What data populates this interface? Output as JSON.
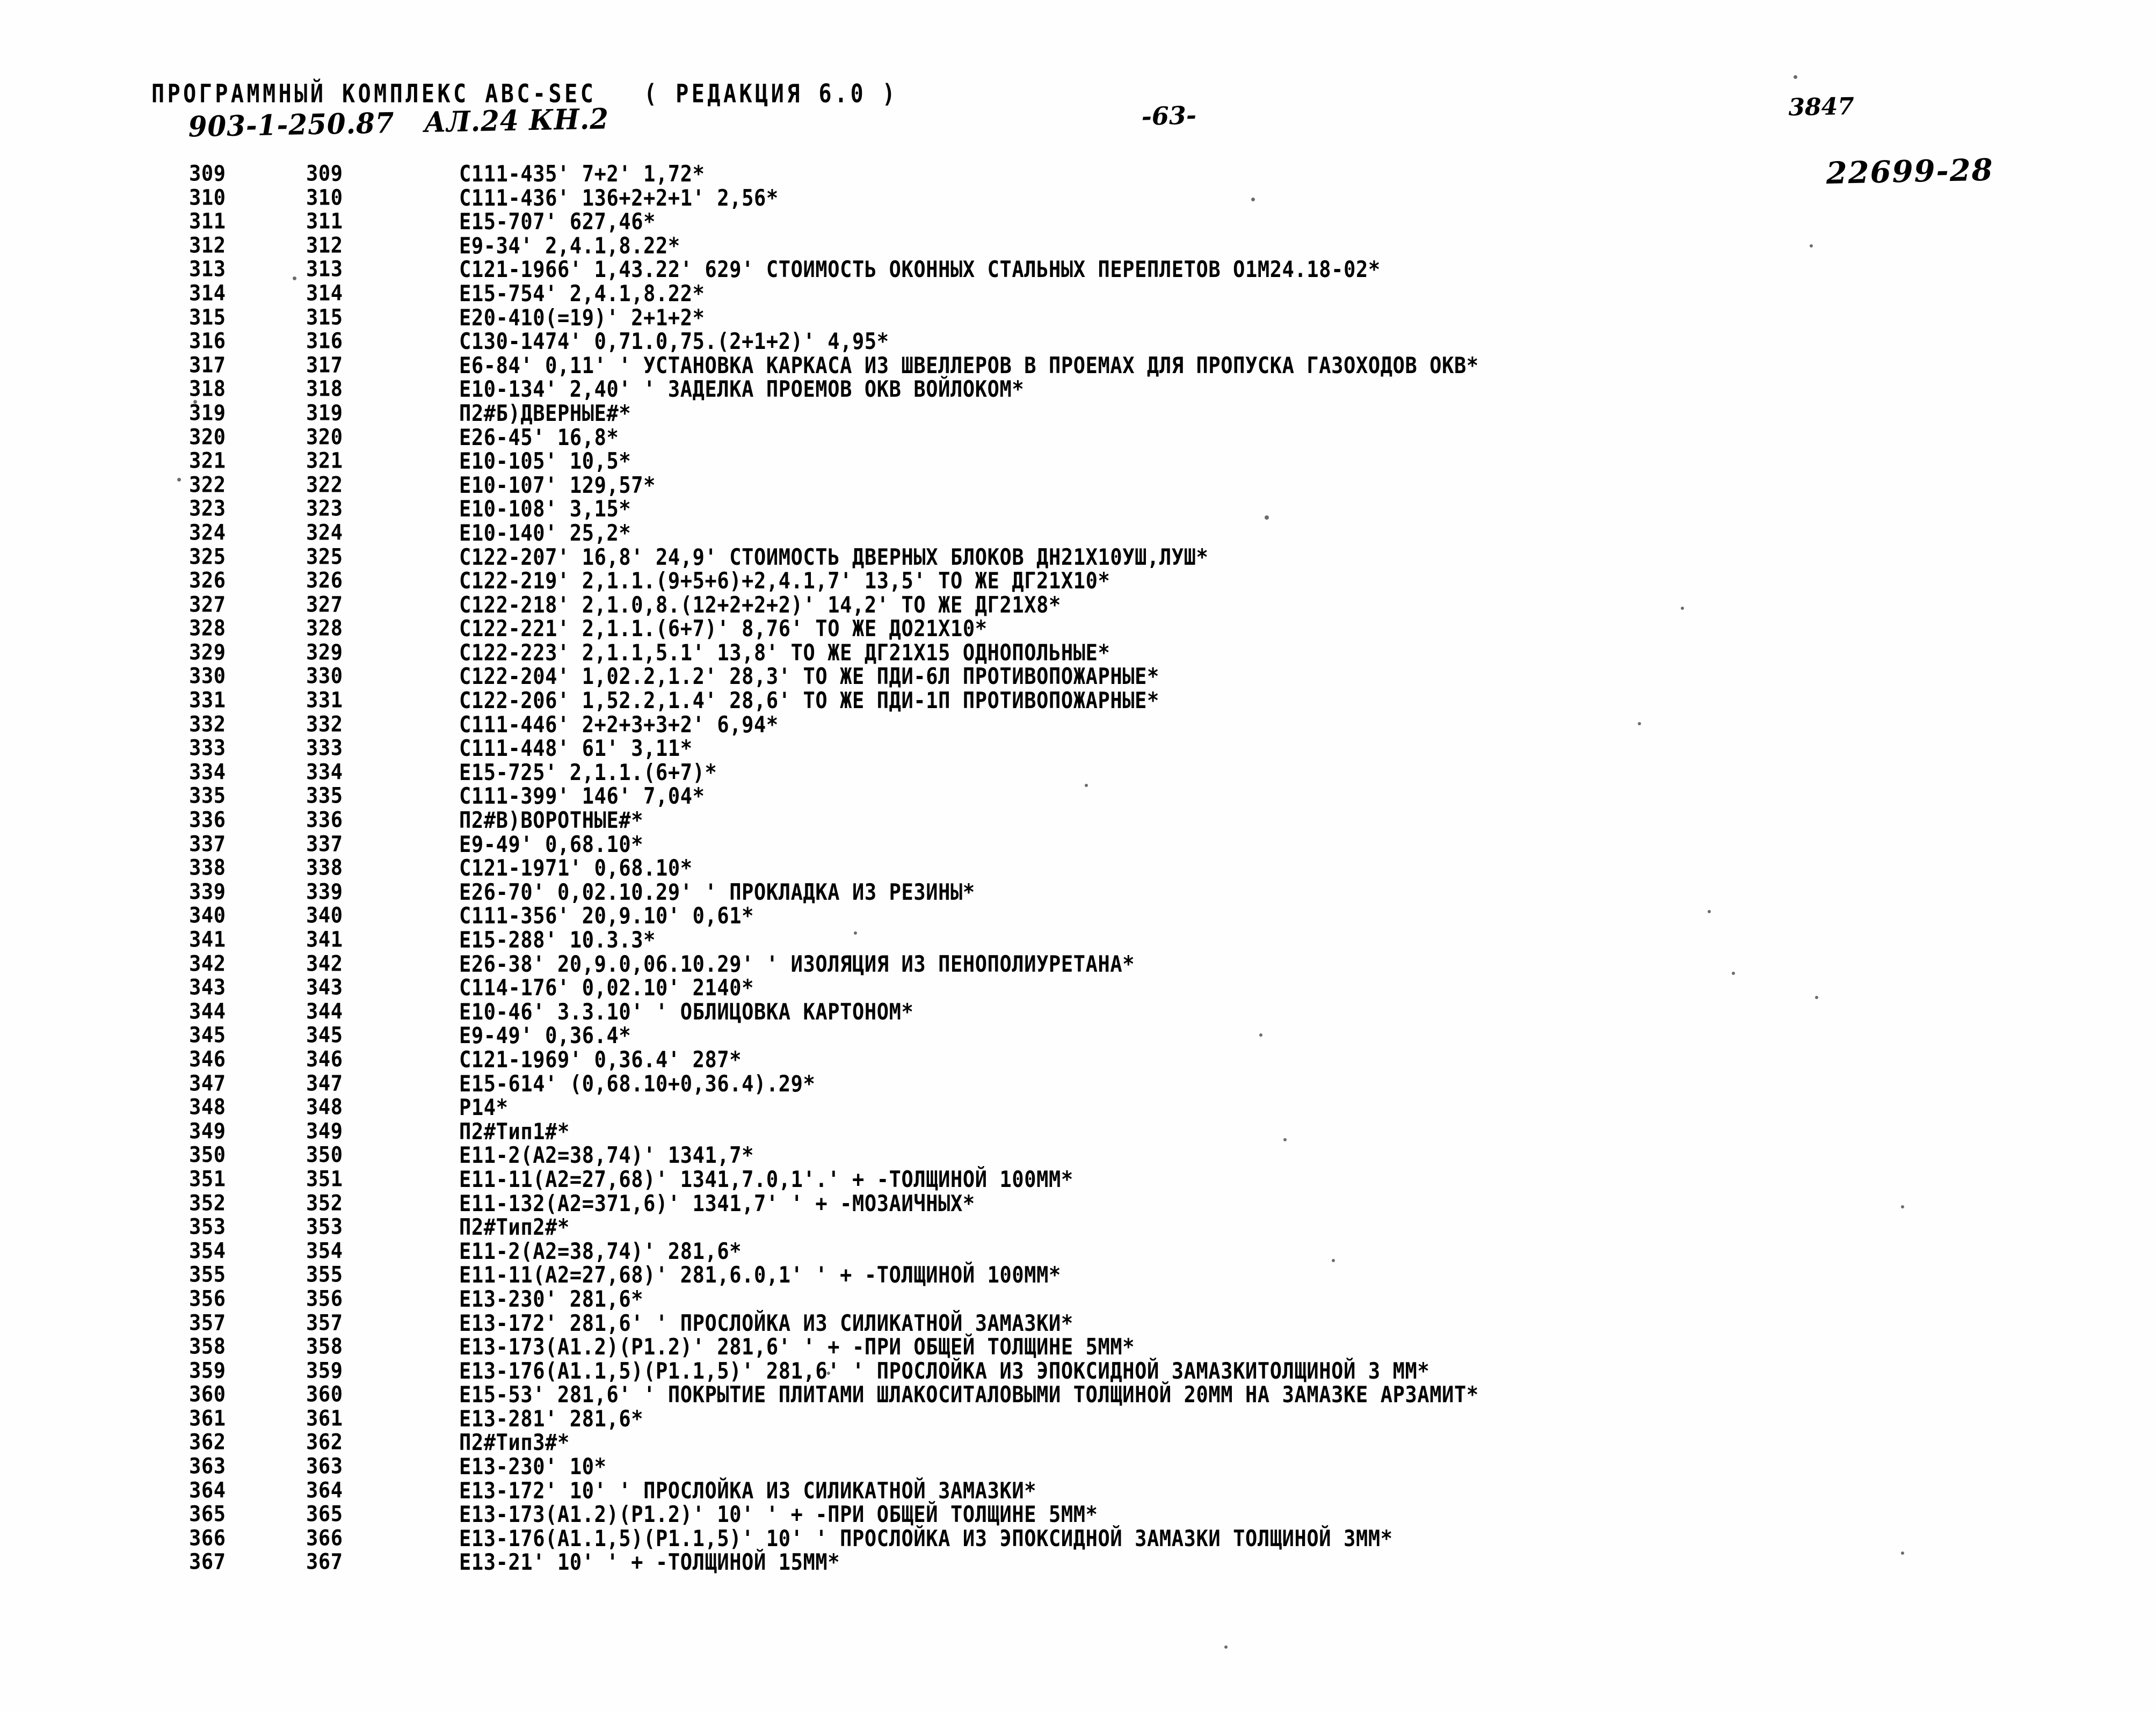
{
  "header": {
    "program_title": "ПРОГРАММНЫЙ КОМПЛЕКС АВС-SEC   ( РЕДАКЦИЯ 6.0 )",
    "handwritten_ref": "903-1-250.87   АЛ.24 КН.2",
    "page_number": "-63-",
    "doc_number": "3847",
    "stamp_number": "22699-28"
  },
  "columns": {
    "seq_header": "",
    "num_header": "",
    "code_header": ""
  },
  "rows": [
    {
      "seq": "309",
      "num": "309",
      "code": "C111-435' 7+2' 1,72*"
    },
    {
      "seq": "310",
      "num": "310",
      "code": "C111-436' 136+2+2+1' 2,56*"
    },
    {
      "seq": "311",
      "num": "311",
      "code": "E15-707' 627,46*"
    },
    {
      "seq": "312",
      "num": "312",
      "code": "E9-34' 2,4.1,8.22*"
    },
    {
      "seq": "313",
      "num": "313",
      "code": "C121-1966' 1,43.22' 629' СТОИМОСТЬ ОКОННЫХ СТАЛЬНЫХ ПЕРЕПЛЕТОВ О1М24.18-02*"
    },
    {
      "seq": "314",
      "num": "314",
      "code": "E15-754' 2,4.1,8.22*"
    },
    {
      "seq": "315",
      "num": "315",
      "code": "E20-410(=19)' 2+1+2*"
    },
    {
      "seq": "316",
      "num": "316",
      "code": "C130-1474' 0,71.0,75.(2+1+2)' 4,95*"
    },
    {
      "seq": "317",
      "num": "317",
      "code": "E6-84' 0,11' ' УСТАНОВКА КАРКАСА ИЗ ШВЕЛЛЕРОВ В ПРОЕМАХ ДЛЯ ПРОПУСКА ГАЗОХОДОВ ОКВ*"
    },
    {
      "seq": "318",
      "num": "318",
      "code": "E10-134' 2,40' ' ЗАДЕЛКА ПРОЕМОВ ОКВ ВОЙЛОКОМ*"
    },
    {
      "seq": "319",
      "num": "319",
      "code": "П2#Б)ДВЕРНЫЕ#*"
    },
    {
      "seq": "320",
      "num": "320",
      "code": "E26-45' 16,8*"
    },
    {
      "seq": "321",
      "num": "321",
      "code": "E10-105' 10,5*"
    },
    {
      "seq": "322",
      "num": "322",
      "code": "E10-107' 129,57*"
    },
    {
      "seq": "323",
      "num": "323",
      "code": "E10-108' 3,15*"
    },
    {
      "seq": "324",
      "num": "324",
      "code": "E10-140' 25,2*"
    },
    {
      "seq": "325",
      "num": "325",
      "code": "C122-207' 16,8' 24,9' СТОИМОСТЬ ДВЕРНЫХ БЛОКОВ ДН21Х10УШ,ЛУШ*"
    },
    {
      "seq": "326",
      "num": "326",
      "code": "C122-219' 2,1.1.(9+5+6)+2,4.1,7' 13,5' ТО ЖЕ ДГ21Х10*"
    },
    {
      "seq": "327",
      "num": "327",
      "code": "C122-218' 2,1.0,8.(12+2+2+2)' 14,2' ТО ЖЕ ДГ21Х8*"
    },
    {
      "seq": "328",
      "num": "328",
      "code": "C122-221' 2,1.1.(6+7)' 8,76' ТО ЖЕ ДО21Х10*"
    },
    {
      "seq": "329",
      "num": "329",
      "code": "C122-223' 2,1.1,5.1' 13,8' ТО ЖЕ ДГ21Х15 ОДНОПОЛЬНЫЕ*"
    },
    {
      "seq": "330",
      "num": "330",
      "code": "C122-204' 1,02.2,1.2' 28,3' ТО ЖЕ ПДИ-6Л ПРОТИВОПОЖАРНЫЕ*"
    },
    {
      "seq": "331",
      "num": "331",
      "code": "C122-206' 1,52.2,1.4' 28,6' ТО ЖЕ ПДИ-1П ПРОТИВОПОЖАРНЫЕ*"
    },
    {
      "seq": "332",
      "num": "332",
      "code": "C111-446' 2+2+3+3+2' 6,94*"
    },
    {
      "seq": "333",
      "num": "333",
      "code": "C111-448' 61' 3,11*"
    },
    {
      "seq": "334",
      "num": "334",
      "code": "E15-725' 2,1.1.(6+7)*"
    },
    {
      "seq": "335",
      "num": "335",
      "code": "C111-399' 146' 7,04*"
    },
    {
      "seq": "336",
      "num": "336",
      "code": "П2#В)ВОРОТНЫЕ#*"
    },
    {
      "seq": "337",
      "num": "337",
      "code": "E9-49' 0,68.10*"
    },
    {
      "seq": "338",
      "num": "338",
      "code": "C121-1971' 0,68.10*"
    },
    {
      "seq": "339",
      "num": "339",
      "code": "E26-70' 0,02.10.29' ' ПРОКЛАДКА ИЗ РЕЗИНЫ*"
    },
    {
      "seq": "340",
      "num": "340",
      "code": "C111-356' 20,9.10' 0,61*"
    },
    {
      "seq": "341",
      "num": "341",
      "code": "E15-288' 10.3.3*"
    },
    {
      "seq": "342",
      "num": "342",
      "code": "E26-38' 20,9.0,06.10.29' ' ИЗОЛЯЦИЯ ИЗ ПЕНОПОЛИУРЕТАНА*"
    },
    {
      "seq": "343",
      "num": "343",
      "code": "C114-176' 0,02.10' 2140*"
    },
    {
      "seq": "344",
      "num": "344",
      "code": "E10-46' 3.3.10' ' ОБЛИЦОВКА КАРТОНОМ*"
    },
    {
      "seq": "345",
      "num": "345",
      "code": "E9-49' 0,36.4*"
    },
    {
      "seq": "346",
      "num": "346",
      "code": "C121-1969' 0,36.4' 287*"
    },
    {
      "seq": "347",
      "num": "347",
      "code": "E15-614' (0,68.10+0,36.4).29*"
    },
    {
      "seq": "348",
      "num": "348",
      "code": "Р14*"
    },
    {
      "seq": "349",
      "num": "349",
      "code": "П2#Тип1#*"
    },
    {
      "seq": "350",
      "num": "350",
      "code": "E11-2(A2=38,74)' 1341,7*"
    },
    {
      "seq": "351",
      "num": "351",
      "code": "E11-11(A2=27,68)' 1341,7.0,1'.' + -ТОЛЩИНОЙ 100ММ*"
    },
    {
      "seq": "352",
      "num": "352",
      "code": "E11-132(A2=371,6)' 1341,7' ' + -МОЗАИЧНЫХ*"
    },
    {
      "seq": "353",
      "num": "353",
      "code": "П2#Тип2#*"
    },
    {
      "seq": "354",
      "num": "354",
      "code": "E11-2(A2=38,74)' 281,6*"
    },
    {
      "seq": "355",
      "num": "355",
      "code": "E11-11(A2=27,68)' 281,6.0,1' ' + -ТОЛЩИНОЙ 100ММ*"
    },
    {
      "seq": "356",
      "num": "356",
      "code": "E13-230' 281,6*"
    },
    {
      "seq": "357",
      "num": "357",
      "code": "E13-172' 281,6' ' ПРОСЛОЙКА ИЗ СИЛИКАТНОЙ ЗАМАЗКИ*"
    },
    {
      "seq": "358",
      "num": "358",
      "code": "E13-173(A1.2)(P1.2)' 281,6' ' + -ПРИ ОБЩЕЙ ТОЛЩИНЕ 5ММ*"
    },
    {
      "seq": "359",
      "num": "359",
      "code": "E13-176(A1.1,5)(P1.1,5)' 281,6' ' ПРОСЛОЙКА ИЗ ЭПОКСИДНОЙ ЗАМАЗКИТОЛЩИНОЙ 3 ММ*"
    },
    {
      "seq": "360",
      "num": "360",
      "code": "E15-53' 281,6' ' ПОКРЫТИЕ ПЛИТАМИ ШЛАКОСИТАЛОВЫМИ ТОЛЩИНОЙ 20ММ НА ЗАМАЗКЕ АРЗАМИТ*"
    },
    {
      "seq": "361",
      "num": "361",
      "code": "E13-281' 281,6*"
    },
    {
      "seq": "362",
      "num": "362",
      "code": "П2#Тип3#*"
    },
    {
      "seq": "363",
      "num": "363",
      "code": "E13-230' 10*"
    },
    {
      "seq": "364",
      "num": "364",
      "code": "E13-172' 10' ' ПРОСЛОЙКА ИЗ СИЛИКАТНОЙ ЗАМАЗКИ*"
    },
    {
      "seq": "365",
      "num": "365",
      "code": "E13-173(A1.2)(P1.2)' 10' ' + -ПРИ ОБЩЕЙ ТОЛЩИНЕ 5ММ*"
    },
    {
      "seq": "366",
      "num": "366",
      "code": "E13-176(A1.1,5)(P1.1,5)' 10' ' ПРОСЛОЙКА ИЗ ЭПОКСИДНОЙ ЗАМАЗКИ ТОЛЩИНОЙ 3ММ*"
    },
    {
      "seq": "367",
      "num": "367",
      "code": "E13-21' 10' ' + -ТОЛЩИНОЙ 15ММ*"
    }
  ]
}
